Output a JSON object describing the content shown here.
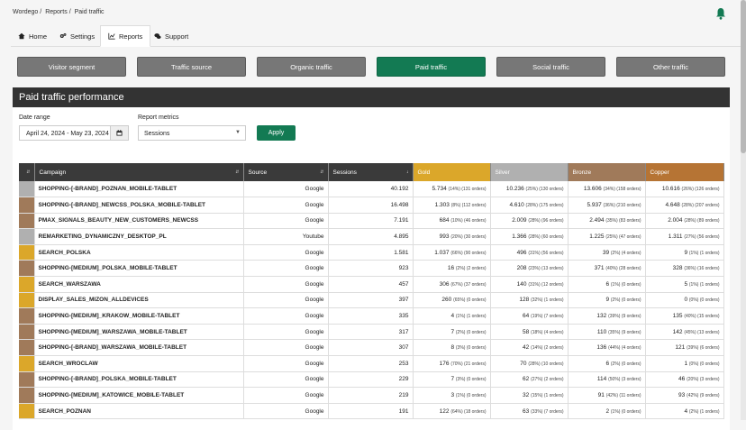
{
  "breadcrumb": [
    "Wordego",
    "Reports",
    "Paid traffic"
  ],
  "tabs": [
    {
      "label": "Home",
      "icon": "home-icon"
    },
    {
      "label": "Settings",
      "icon": "gears-icon"
    },
    {
      "label": "Reports",
      "icon": "chart-icon"
    },
    {
      "label": "Support",
      "icon": "chat-icon"
    }
  ],
  "segments": [
    "Visitor segment",
    "Traffic source",
    "Organic traffic",
    "Paid traffic",
    "Social traffic",
    "Other traffic"
  ],
  "active_segment": "Paid traffic",
  "panel": {
    "title": "Paid traffic performance",
    "date_label": "Date range",
    "date_value": "April 24, 2024 - May 23, 2024",
    "metric_label": "Report metrics",
    "metric_value": "Sessions",
    "apply_label": "Apply"
  },
  "colors": {
    "gold": "#dba72a",
    "silver": "#b0b0b0",
    "bronze": "#a07a5a",
    "copper": "#b67434",
    "header_dark": "#3a3a3a",
    "accent": "#137a53"
  },
  "table": {
    "headers": [
      "",
      "Campaign",
      "Source",
      "Sessions",
      "Gold",
      "Silver",
      "Bronze",
      "Copper"
    ],
    "rows": [
      {
        "tier": "silver",
        "campaign": "SHOPPING-[-BRAND]_POZNAN_MOBILE-TABLET",
        "source": "Google",
        "sessions": "40.192",
        "gold": "5.734",
        "gold_pct": "(14%) (131 orders)",
        "silver": "10.236",
        "silver_pct": "(25%) (130 orders)",
        "bronze": "13.606",
        "bronze_pct": "(34%) (158 orders)",
        "copper": "10.616",
        "copper_pct": "(26%) (126 orders)"
      },
      {
        "tier": "bronze",
        "campaign": "SHOPPING-[-BRAND]_NEWCSS_POLSKA_MOBILE-TABLET",
        "source": "Google",
        "sessions": "16.498",
        "gold": "1.303",
        "gold_pct": "(8%) (112 orders)",
        "silver": "4.610",
        "silver_pct": "(28%) (175 orders)",
        "bronze": "5.937",
        "bronze_pct": "(36%) (210 orders)",
        "copper": "4.648",
        "copper_pct": "(28%) (207 orders)"
      },
      {
        "tier": "bronze",
        "campaign": "PMAX_SIGNALS_BEAUTY_NEW_CUSTOMERS_NEWCSS",
        "source": "Google",
        "sessions": "7.191",
        "gold": "684",
        "gold_pct": "(10%) (46 orders)",
        "silver": "2.009",
        "silver_pct": "(28%) (96 orders)",
        "bronze": "2.494",
        "bronze_pct": "(35%) (83 orders)",
        "copper": "2.004",
        "copper_pct": "(28%) (89 orders)"
      },
      {
        "tier": "silver",
        "campaign": "REMARKETING_DYNAMICZNY_DESKTOP_PL",
        "source": "Youtube",
        "sessions": "4.895",
        "gold": "993",
        "gold_pct": "(20%) (30 orders)",
        "silver": "1.366",
        "silver_pct": "(28%) (60 orders)",
        "bronze": "1.225",
        "bronze_pct": "(25%) (47 orders)",
        "copper": "1.311",
        "copper_pct": "(27%) (56 orders)"
      },
      {
        "tier": "gold",
        "campaign": "SEARCH_POLSKA",
        "source": "Google",
        "sessions": "1.581",
        "gold": "1.037",
        "gold_pct": "(66%) (90 orders)",
        "silver": "496",
        "silver_pct": "(31%) (56 orders)",
        "bronze": "39",
        "bronze_pct": "(2%) (4 orders)",
        "copper": "9",
        "copper_pct": "(1%) (1 orders)"
      },
      {
        "tier": "bronze",
        "campaign": "SHOPPING-[MEDIUM]_POLSKA_MOBILE-TABLET",
        "source": "Google",
        "sessions": "923",
        "gold": "16",
        "gold_pct": "(2%) (2 orders)",
        "silver": "208",
        "silver_pct": "(23%) (13 orders)",
        "bronze": "371",
        "bronze_pct": "(40%) (28 orders)",
        "copper": "328",
        "copper_pct": "(36%) (16 orders)"
      },
      {
        "tier": "gold",
        "campaign": "SEARCH_WARSZAWA",
        "source": "Google",
        "sessions": "457",
        "gold": "306",
        "gold_pct": "(67%) (37 orders)",
        "silver": "140",
        "silver_pct": "(31%) (12 orders)",
        "bronze": "6",
        "bronze_pct": "(1%) (0 orders)",
        "copper": "5",
        "copper_pct": "(1%) (1 orders)"
      },
      {
        "tier": "gold",
        "campaign": "DISPLAY_SALES_MIZON_ALLDEVICES",
        "source": "Google",
        "sessions": "397",
        "gold": "260",
        "gold_pct": "(65%) (0 orders)",
        "silver": "128",
        "silver_pct": "(32%) (1 orders)",
        "bronze": "9",
        "bronze_pct": "(2%) (0 orders)",
        "copper": "0",
        "copper_pct": "(0%) (0 orders)"
      },
      {
        "tier": "bronze",
        "campaign": "SHOPPING-[MEDIUM]_KRAKOW_MOBILE-TABLET",
        "source": "Google",
        "sessions": "335",
        "gold": "4",
        "gold_pct": "(1%) (1 orders)",
        "silver": "64",
        "silver_pct": "(19%) (7 orders)",
        "bronze": "132",
        "bronze_pct": "(39%) (9 orders)",
        "copper": "135",
        "copper_pct": "(40%) (15 orders)"
      },
      {
        "tier": "bronze",
        "campaign": "SHOPPING-[MEDIUM]_WARSZAWA_MOBILE-TABLET",
        "source": "Google",
        "sessions": "317",
        "gold": "7",
        "gold_pct": "(2%) (0 orders)",
        "silver": "58",
        "silver_pct": "(18%) (4 orders)",
        "bronze": "110",
        "bronze_pct": "(35%) (9 orders)",
        "copper": "142",
        "copper_pct": "(45%) (13 orders)"
      },
      {
        "tier": "bronze",
        "campaign": "SHOPPING-[-BRAND]_WARSZAWA_MOBILE-TABLET",
        "source": "Google",
        "sessions": "307",
        "gold": "8",
        "gold_pct": "(3%) (0 orders)",
        "silver": "42",
        "silver_pct": "(14%) (2 orders)",
        "bronze": "136",
        "bronze_pct": "(44%) (4 orders)",
        "copper": "121",
        "copper_pct": "(39%) (6 orders)"
      },
      {
        "tier": "gold",
        "campaign": "SEARCH_WROCLAW",
        "source": "Google",
        "sessions": "253",
        "gold": "176",
        "gold_pct": "(70%) (21 orders)",
        "silver": "70",
        "silver_pct": "(28%) (10 orders)",
        "bronze": "6",
        "bronze_pct": "(2%) (0 orders)",
        "copper": "1",
        "copper_pct": "(0%) (0 orders)"
      },
      {
        "tier": "bronze",
        "campaign": "SHOPPING-[-BRAND]_POLSKA_MOBILE-TABLET",
        "source": "Google",
        "sessions": "229",
        "gold": "7",
        "gold_pct": "(3%) (0 orders)",
        "silver": "62",
        "silver_pct": "(27%) (2 orders)",
        "bronze": "114",
        "bronze_pct": "(50%) (3 orders)",
        "copper": "46",
        "copper_pct": "(20%) (3 orders)"
      },
      {
        "tier": "bronze",
        "campaign": "SHOPPING-[MEDIUM]_KATOWICE_MOBILE-TABLET",
        "source": "Google",
        "sessions": "219",
        "gold": "3",
        "gold_pct": "(1%) (0 orders)",
        "silver": "32",
        "silver_pct": "(15%) (1 orders)",
        "bronze": "91",
        "bronze_pct": "(42%) (11 orders)",
        "copper": "93",
        "copper_pct": "(42%) (9 orders)"
      },
      {
        "tier": "gold",
        "campaign": "SEARCH_POZNAN",
        "source": "Google",
        "sessions": "191",
        "gold": "122",
        "gold_pct": "(64%) (18 orders)",
        "silver": "63",
        "silver_pct": "(33%) (7 orders)",
        "bronze": "2",
        "bronze_pct": "(1%) (0 orders)",
        "copper": "4",
        "copper_pct": "(2%) (1 orders)"
      }
    ]
  }
}
